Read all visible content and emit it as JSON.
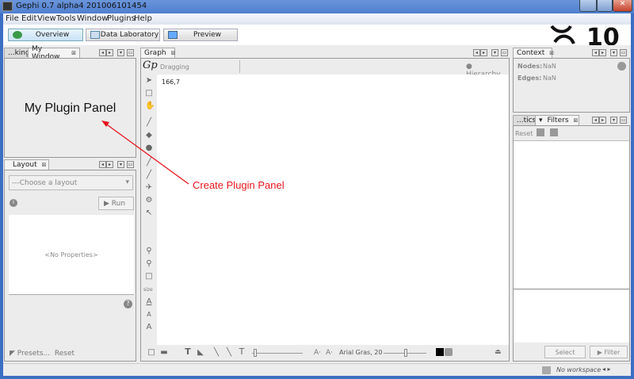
{
  "window": {
    "title": "Gephi 0.7 alpha4 201006101454"
  },
  "menu": [
    "File",
    "Edit",
    "View",
    "Tools",
    "Window",
    "Plugins",
    "Help"
  ],
  "perspectives": [
    {
      "label": "Overview",
      "icon": "globe-icon",
      "active": true
    },
    {
      "label": "Data Laboratory",
      "icon": "table-icon"
    },
    {
      "label": "Preview",
      "icon": "monitor-icon"
    }
  ],
  "left_top": {
    "tabs": [
      "...king",
      "My Window"
    ],
    "content": "My Plugin Panel"
  },
  "layout": {
    "tab": "Layout",
    "select_placeholder": "---Choose a layout",
    "run": "Run",
    "no_properties": "<No Properties>",
    "presets": "Presets...",
    "reset": "Reset"
  },
  "graph": {
    "tab": "Graph",
    "mode": "Dragging",
    "hierarchy": "Hierarchy",
    "coords": "166,7",
    "side_tools": [
      "pointer",
      "rect-select",
      "drag",
      "painter-brush",
      "diamond",
      "globe",
      "pencil",
      "line",
      "airplane",
      "gear",
      "cursor-help"
    ],
    "zoom_tools": [
      "zoom-in",
      "zoom-out",
      "square",
      "size",
      "text-a",
      "text-a-small",
      "text-a-outline"
    ],
    "font_label": "Arial Gras, 20"
  },
  "context": {
    "tab": "Context",
    "nodes_label": "Nodes:",
    "nodes": "NaN",
    "edges_label": "Edges:",
    "edges": "NaN"
  },
  "filters": {
    "tabs": [
      "...tics",
      "Filters"
    ],
    "reset": "Reset",
    "select": "Select",
    "filter": "Filter"
  },
  "status": {
    "workspace": "No workspace"
  },
  "annotation": {
    "text": "Create Plugin Panel",
    "color": "#e8141c"
  }
}
